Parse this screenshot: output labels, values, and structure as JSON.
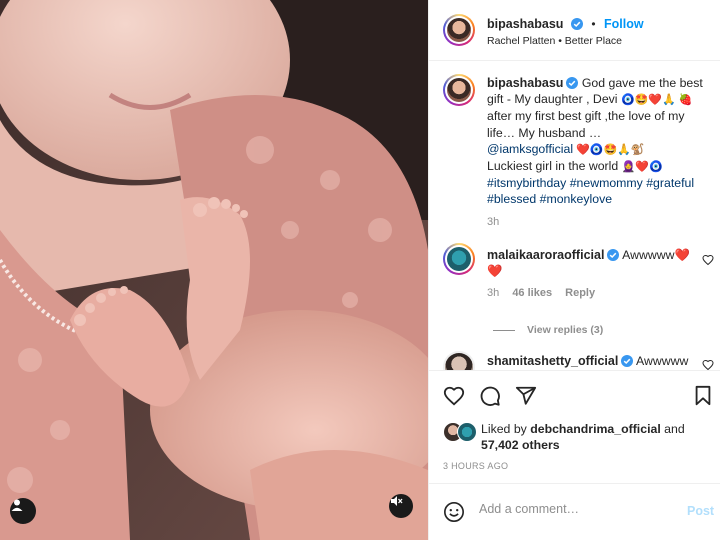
{
  "post": {
    "author": "bipashabasu",
    "follow_label": "Follow",
    "separator": "•",
    "audio": "Rachel Platten • Better Place"
  },
  "caption": {
    "author": "bipashabasu",
    "text_1": "God gave me the best gift - My daughter , Devi ",
    "emoji_1": "🧿🤩❤️🙏 🍓",
    "text_2": " after my first best gift ,the love of my life… My husband … ",
    "mention": "@iamksgofficial",
    "emoji_2": " ❤️🧿🤩🙏🐒",
    "text_3": " Luckiest girl in the world ",
    "emoji_3": "🧕❤️🧿",
    "hashtags": "#itsmybirthday #newmommy #grateful #blessed #monkeylove",
    "time": "3h"
  },
  "comments": [
    {
      "author": "malaikaaroraofficial",
      "text": "Awwwww❤️ ❤️",
      "time": "3h",
      "likes": "46 likes",
      "reply_label": "Reply",
      "view_replies": "View replies (3)"
    },
    {
      "author": "shamitashetty_official",
      "text": "Awwwww"
    }
  ],
  "likes": {
    "prefix": "Liked by ",
    "user": "debchandrima_official",
    "mid": " and",
    "others": "57,402 others"
  },
  "timestamp": "3 HOURS AGO",
  "add_comment": {
    "placeholder": "Add a comment…",
    "post_label": "Post"
  },
  "colors": {
    "accent": "#0095f6",
    "verified": "#3897f0",
    "like_red": "#ed4956",
    "muted": "#8e8e8e"
  },
  "icons": [
    "user-tag-icon",
    "mute-icon",
    "verified-icon",
    "heart-icon",
    "comment-icon",
    "share-icon",
    "bookmark-icon",
    "emoji-icon"
  ]
}
